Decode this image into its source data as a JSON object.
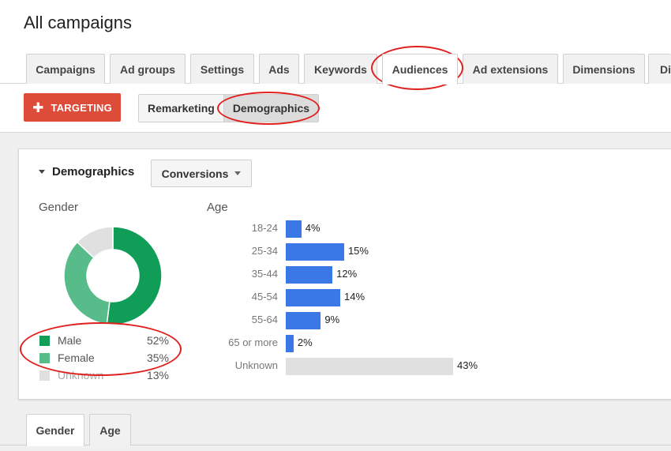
{
  "page": {
    "title": "All campaigns"
  },
  "tabs": [
    {
      "label": "Campaigns",
      "active": false
    },
    {
      "label": "Ad groups",
      "active": false
    },
    {
      "label": "Settings",
      "active": false
    },
    {
      "label": "Ads",
      "active": false
    },
    {
      "label": "Keywords",
      "active": false
    },
    {
      "label": "Audiences",
      "active": true
    },
    {
      "label": "Ad extensions",
      "active": false
    },
    {
      "label": "Dimensions",
      "active": false
    },
    {
      "label": "Di",
      "active": false
    }
  ],
  "subbar": {
    "targeting_icon": "plus-icon",
    "targeting_label": "TARGETING",
    "segments": [
      {
        "label": "Remarketing",
        "active": false
      },
      {
        "label": "Demographics",
        "active": true
      }
    ]
  },
  "card": {
    "title": "Demographics",
    "collapse_icon": "triangle-down-icon",
    "metric_dropdown": {
      "label": "Conversions",
      "icon": "caret-down-icon"
    }
  },
  "gender": {
    "title": "Gender",
    "items": [
      {
        "name": "Male",
        "value": 52,
        "display": "52%",
        "color": "#0f9d58"
      },
      {
        "name": "Female",
        "value": 35,
        "display": "35%",
        "color": "#57bb8a"
      },
      {
        "name": "Unknown",
        "value": 13,
        "display": "13%",
        "color": "#e0e0e0"
      }
    ]
  },
  "age": {
    "title": "Age",
    "bar_color": "#3b78e7",
    "unknown_color": "#e0e0e0",
    "items": [
      {
        "label": "18-24",
        "value": 4,
        "display": "4%"
      },
      {
        "label": "25-34",
        "value": 15,
        "display": "15%"
      },
      {
        "label": "35-44",
        "value": 12,
        "display": "12%"
      },
      {
        "label": "45-54",
        "value": 14,
        "display": "14%"
      },
      {
        "label": "55-64",
        "value": 9,
        "display": "9%"
      },
      {
        "label": "65 or more",
        "value": 2,
        "display": "2%"
      },
      {
        "label": "Unknown",
        "value": 43,
        "display": "43%"
      }
    ]
  },
  "bottom_tabs": [
    {
      "label": "Gender",
      "active": true
    },
    {
      "label": "Age",
      "active": false
    }
  ],
  "annotation_color": "#e0201e"
}
